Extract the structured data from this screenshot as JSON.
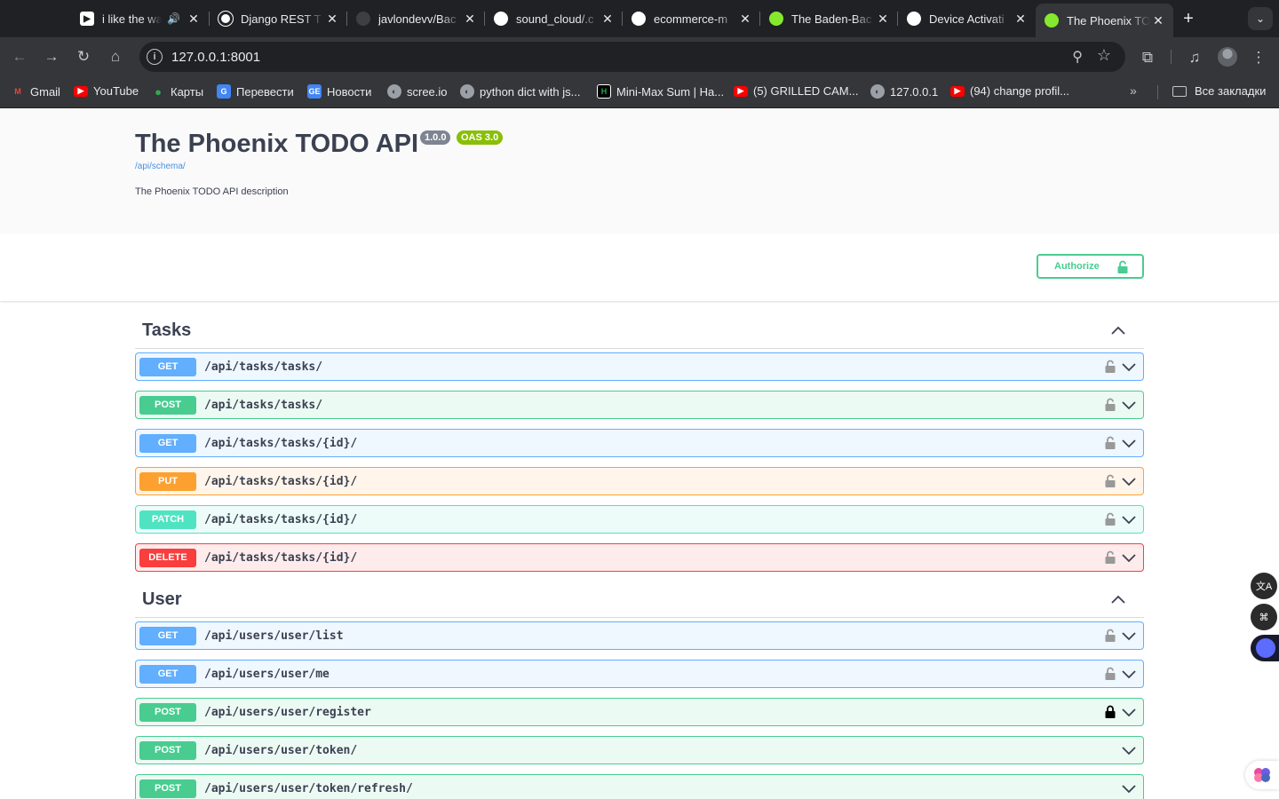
{
  "browser": {
    "tabs": [
      {
        "title": "i like the way",
        "favicon_color": "#ffffff",
        "audio": true
      },
      {
        "title": "Django REST T",
        "favicon_color": "#ffffff"
      },
      {
        "title": "javlondevv/Bac",
        "favicon_color": "#3c4043"
      },
      {
        "title": "sound_cloud/.c",
        "favicon_color": "#ffffff"
      },
      {
        "title": "ecommerce-m",
        "favicon_color": "#ffffff"
      },
      {
        "title": "The Baden-Bac",
        "favicon_color": "#85ea2d"
      },
      {
        "title": "Device Activati",
        "favicon_color": "#ffffff"
      },
      {
        "title": "The Phoenix TO",
        "favicon_color": "#85ea2d",
        "active": true
      }
    ],
    "url": "127.0.0.1:8001",
    "bookmarks": [
      {
        "label": "Gmail",
        "icon": "gmail-icon",
        "color": "#ea4335"
      },
      {
        "label": "YouTube",
        "icon": "youtube-icon",
        "color": "#ff0000"
      },
      {
        "label": "Карты",
        "icon": "maps-icon",
        "color": "#34a853"
      },
      {
        "label": "Перевести",
        "icon": "translate-icon",
        "color": "#4285f4"
      },
      {
        "label": "Новости",
        "icon": "news-icon",
        "color": "#4285f4"
      },
      {
        "label": "scree.io",
        "icon": "globe-icon",
        "color": "#9aa0a6"
      },
      {
        "label": "python dict with js...",
        "icon": "globe-icon",
        "color": "#9aa0a6"
      },
      {
        "label": "Mini-Max Sum | Ha...",
        "icon": "hackerrank-icon",
        "color": "#000000"
      },
      {
        "label": "(5) GRILLED CAM...",
        "icon": "youtube-icon",
        "color": "#ff0000"
      },
      {
        "label": "127.0.0.1",
        "icon": "globe-icon",
        "color": "#9aa0a6"
      },
      {
        "label": "(94) change profil...",
        "icon": "youtube-icon",
        "color": "#ff0000"
      }
    ],
    "all_bookmarks": "Все закладки"
  },
  "info": {
    "title": "The Phoenix TODO API",
    "version": "1.0.0",
    "oas": "OAS 3.0",
    "schema_link": "/api/schema/",
    "description": "The Phoenix TODO API description"
  },
  "authorize_label": "Authorize",
  "tags": [
    {
      "name": "Tasks",
      "operations": [
        {
          "method": "GET",
          "path": "/api/tasks/tasks/",
          "locked": false
        },
        {
          "method": "POST",
          "path": "/api/tasks/tasks/",
          "locked": false
        },
        {
          "method": "GET",
          "path": "/api/tasks/tasks/{id}/",
          "locked": false
        },
        {
          "method": "PUT",
          "path": "/api/tasks/tasks/{id}/",
          "locked": false
        },
        {
          "method": "PATCH",
          "path": "/api/tasks/tasks/{id}/",
          "locked": false
        },
        {
          "method": "DELETE",
          "path": "/api/tasks/tasks/{id}/",
          "locked": false
        }
      ]
    },
    {
      "name": "User",
      "operations": [
        {
          "method": "GET",
          "path": "/api/users/user/list",
          "locked": false
        },
        {
          "method": "GET",
          "path": "/api/users/user/me",
          "locked": false
        },
        {
          "method": "POST",
          "path": "/api/users/user/register",
          "locked": true
        },
        {
          "method": "POST",
          "path": "/api/users/user/token/",
          "no_lock": true
        },
        {
          "method": "POST",
          "path": "/api/users/user/token/refresh/",
          "no_lock": true
        }
      ]
    }
  ],
  "colors": {
    "get": "#61affe",
    "post": "#49cc90",
    "put": "#fca130",
    "patch": "#50e3c2",
    "delete": "#f93e3e"
  }
}
